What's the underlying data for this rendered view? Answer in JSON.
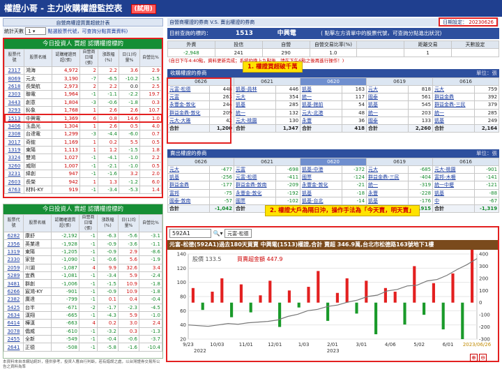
{
  "header": {
    "title": "權證小哥 - 主力收購權證監控表",
    "tag": "(試用)"
  },
  "left_controls": {
    "subtitle": "自營商權證買賣超統計表",
    "days_label": "統計天數",
    "days_value": "1",
    "hint": "點選股票代號，可查詢分點買賣資料)"
  },
  "foreign": {
    "title": "今日投資人 買超 認購權證標的",
    "headers": [
      "股票代號",
      "股票名稱",
      "認購權證買超(張)",
      "自營商日增(張)",
      "漲跌幅(%)",
      "日(1)均量%",
      "自營比%"
    ],
    "rows": [
      [
        "2317",
        "鴻海",
        "4,972",
        "2",
        "2.2",
        "3.6",
        "2.9"
      ],
      [
        "8069",
        "元太",
        "3,190",
        "-7",
        "-6.5",
        "-10.2",
        "-1.5"
      ],
      [
        "2618",
        "長榮航",
        "2,973",
        "2",
        "2.2",
        "0.0",
        "2.5"
      ],
      [
        "2303",
        "聯電",
        "1,964",
        "-1",
        "-1.1",
        "-2.2",
        "19.7"
      ],
      [
        "3443",
        "創意",
        "1,804",
        "-3",
        "-0.6",
        "-1.8",
        "0.3"
      ],
      [
        "3293",
        "鈊象",
        "1,768",
        "1",
        "2.6",
        "2.6",
        "10.7"
      ],
      [
        "1513",
        "中興電",
        "1,369",
        "6",
        "0.8",
        "14.6",
        "1.0"
      ],
      [
        "3406",
        "玉晶光",
        "1,304",
        "1",
        "2.6",
        "0.5",
        "4.0"
      ],
      [
        "2308",
        "台達電",
        "1,299",
        "-3",
        "-4.4",
        "-6.0",
        "0.7"
      ],
      [
        "3017",
        "奇鋐",
        "1,169",
        "1",
        "0.2",
        "5.5",
        "0.5"
      ],
      [
        "1319",
        "東陽",
        "1,113",
        "1",
        "1.2",
        "-1.5",
        "1.8"
      ],
      [
        "3324",
        "雙鴻",
        "1,027",
        "-1",
        "-4.1",
        "-1.0",
        "2.2"
      ],
      [
        "3260",
        "威剛",
        "1,007",
        "-1",
        "-2.1",
        "-1.0",
        "0.5"
      ],
      [
        "3231",
        "緯創",
        "947",
        "-1",
        "-1.6",
        "3.2",
        "2.0"
      ],
      [
        "2603",
        "長榮",
        "942",
        "1",
        "1.3",
        "-1.2",
        "6.0"
      ],
      [
        "4763",
        "材料-KY",
        "919",
        "-1",
        "-3.4",
        "-5.3",
        "1.4"
      ]
    ]
  },
  "dealer": {
    "title": "今日投資人 賣超 認購權證標的",
    "headers": [
      "股票代號",
      "股票名稱",
      "認購權證賣超(張)",
      "自營商日增(張)",
      "漲跌幅(%)",
      "日(1)均量%",
      "自營比%"
    ],
    "rows": [
      [
        "6282",
        "康舒",
        "-2,192",
        "-1",
        "-6.3",
        "-5.6",
        "-3.1"
      ],
      [
        "2356",
        "英業達",
        "-1,928",
        "-1",
        "-0.9",
        "-3.6",
        "-1.1"
      ],
      [
        "1319",
        "東陽",
        "-1,205",
        "-1",
        "-0.9",
        "2.9",
        "-8.6"
      ],
      [
        "2330",
        "家登",
        "-1,090",
        "-1",
        "-0.6",
        "5.6",
        "-1.9"
      ],
      [
        "2059",
        "川湖",
        "-1,087",
        "4",
        "9.9",
        "32.6",
        "3.4"
      ],
      [
        "5289",
        "宜鼎",
        "-1,081",
        "-1",
        "-3.4",
        "5.9",
        "-2.4"
      ],
      [
        "3481",
        "群創",
        "-1,006",
        "-1",
        "-1.5",
        "10.9",
        "-1.8"
      ],
      [
        "6266",
        "宸鴻-KY",
        "-901",
        "-1",
        "-0.9",
        "10.9",
        "-1.8"
      ],
      [
        "2382",
        "廣達",
        "-799",
        "-1",
        "0.1",
        "0.4",
        "-0.4"
      ],
      [
        "5425",
        "台半",
        "-671",
        "-2",
        "-1.7",
        "-2.3",
        "-4.5"
      ],
      [
        "2634",
        "漢翔",
        "-665",
        "-1",
        "-4.3",
        "5.9",
        "-1.0"
      ],
      [
        "6414",
        "樺漢",
        "-663",
        "4",
        "0.2",
        "3.0",
        "2.4"
      ],
      [
        "3078",
        "僑威",
        "-610",
        "-1",
        "-3.2",
        "0.3",
        "-1.3"
      ],
      [
        "2455",
        "全新",
        "-549",
        "-1",
        "-0.4",
        "-0.6",
        "-3.7"
      ],
      [
        "2641",
        "正德",
        "-508",
        "-1",
        "-5.8",
        "-1.6",
        "-10.4"
      ]
    ]
  },
  "footnote": "本資料來自本網站統計，僅供參考，投資人應自行判斷，若有錯誤之處，以台灣證券交易所公告之資料為準",
  "right": {
    "subtitle": "自營商權證的券商 V.S. 賣出權證的券商",
    "date_label": "日期設定",
    "date_value": "20230626",
    "target_label": "目前查詢的標的：",
    "target_code": "1513",
    "target_name": "中興電",
    "target_hint": "( 點擊左方清單中的股票代號，可查詢分點進出狀況)",
    "summary_headers": [
      "外資",
      "投信",
      "自營",
      "自營交易比率(%)",
      "",
      "距離交易",
      "天數設定"
    ],
    "summary_values": [
      "-2,948",
      "241",
      "290",
      "1.0",
      "",
      "1",
      ""
    ],
    "note": "(自日下午4:40點，資料更新完成；系統約晚上九點後，請在下午6點之後再進行操作！)",
    "unit": "單位：張",
    "buy_title": "收購權證的券商",
    "sell_title": "賣出權證的券商",
    "dates": [
      "0626",
      "0621",
      "0620",
      "0619",
      "0616"
    ],
    "buy_rows": [
      [
        [
          "元富-松德",
          "448"
        ],
        [
          "凱基-員林",
          "446"
        ],
        [
          "凱基",
          "163"
        ],
        [
          "元大",
          "818"
        ],
        [
          "元大",
          "759"
        ]
      ],
      [
        [
          "元富",
          "263"
        ],
        [
          "元大",
          "354"
        ],
        [
          "統一",
          "117"
        ],
        [
          "國泰",
          "561"
        ],
        [
          "群益金鼎",
          "392"
        ]
      ],
      [
        [
          "永豐金-敦化",
          "244"
        ],
        [
          "凱基",
          "285"
        ],
        [
          "凱基-館前",
          "54"
        ],
        [
          "凱基",
          "545"
        ],
        [
          "群益金鼎-三民",
          "379"
        ]
      ],
      [
        [
          "群益金鼎-敦化",
          "209"
        ],
        [
          "統一",
          "132"
        ],
        [
          "元大-北港",
          "48"
        ],
        [
          "統一",
          "203"
        ],
        [
          "統一",
          "285"
        ]
      ],
      [
        [
          "元大-大雅",
          "42"
        ],
        [
          "元大-桃園",
          "130"
        ],
        [
          "永豐",
          "36"
        ],
        [
          "國泰",
          "133"
        ],
        [
          "凱基",
          "249"
        ]
      ]
    ],
    "buy_totals": [
      "1,200",
      "1,347",
      "418",
      "2,260",
      "2,164"
    ],
    "sell_rows": [
      [
        [
          "元大",
          "-477"
        ],
        [
          "元富",
          "-698"
        ],
        [
          "凱基-中港",
          "-372"
        ],
        [
          "元大",
          "-685"
        ],
        [
          "元大-桃園",
          "-901"
        ]
      ],
      [
        [
          "凱基",
          "-256"
        ],
        [
          "元富-松德",
          "-411"
        ],
        [
          "國票",
          "-124"
        ],
        [
          "群益金鼎-三民",
          "-404"
        ],
        [
          "富邦-木柵",
          "-141"
        ]
      ],
      [
        [
          "群益金鼎",
          "-177"
        ],
        [
          "群益金鼎-敦南",
          "-209"
        ],
        [
          "永豐金-敦化",
          "-21"
        ],
        [
          "統一",
          "-319"
        ],
        [
          "統一中壢",
          "-121"
        ]
      ],
      [
        [
          "富邦",
          "-75"
        ],
        [
          "永豐金-敦化",
          "-192"
        ],
        [
          "凱基",
          "-18"
        ],
        [
          "永豐",
          "-228"
        ],
        [
          "凱基",
          "-88"
        ]
      ],
      [
        [
          "國泰-敦南",
          "-57"
        ],
        [
          "國票",
          "-102"
        ],
        [
          "凱基-台北",
          "-14"
        ],
        [
          "凱基",
          "-176"
        ],
        [
          "中",
          "-67"
        ]
      ]
    ],
    "sell_totals": [
      "-1,042",
      "-1,683",
      "-433",
      "-1,915",
      "-1,319"
    ],
    "total_label": "合計",
    "callout1": "1. 權證買超破千萬",
    "callout2": "2. 權證大戶為隔日沖，操作手法為「今天賣，明天賣」"
  },
  "chart_panel": {
    "input_value": "592A1",
    "branch_btn": "元富-松德",
    "banner": "元富-松德(592A1)過去180天買賣 中興電(1513)權證,合計 賣超 346.9萬,台北市松德路163號地下1樓",
    "legend_price": "股價",
    "legend_price_value": "133.5",
    "legend_buy": "買賣超金額",
    "legend_buy_value": "447.9"
  },
  "chart_data": {
    "type": "bar",
    "x": [
      "9/23",
      "10/03",
      "11/01",
      "12/01",
      "1/03",
      "2/01",
      "3/01",
      "4/06",
      "5/02",
      "6/01",
      "2023/06/26"
    ],
    "x_year_labels": [
      "2022",
      "2023",
      "2022"
    ],
    "left_ticks": [
      140,
      120,
      100,
      80,
      60,
      40,
      20
    ],
    "right_ticks": [
      400,
      300,
      200,
      100,
      0,
      -100,
      -200,
      -300
    ],
    "series": [
      {
        "name": "股價",
        "type": "line",
        "values": [
          40,
          39,
          38,
          40,
          42,
          41,
          43,
          44,
          45,
          47,
          52,
          55,
          60,
          62,
          66,
          68,
          72,
          75,
          80,
          82,
          88,
          90,
          95,
          96,
          102,
          104,
          110,
          118,
          125,
          133.5
        ]
      },
      {
        "name": "買賣超金額",
        "type": "bar",
        "values": [
          120,
          -60,
          90,
          200,
          -120,
          150,
          -80,
          60,
          180,
          -200,
          100,
          -40,
          130,
          260,
          -150,
          80,
          200,
          -90,
          180,
          -260,
          120,
          90,
          -180,
          300,
          -100,
          160,
          -220,
          240,
          -300,
          447.9
        ]
      }
    ],
    "ylim_left": [
      20,
      140
    ],
    "ylim_right": [
      -300,
      400
    ]
  },
  "colors": {
    "header_bg": "#1f3f8f",
    "green": "#158e35",
    "blue": "#2d4f9e",
    "red": "#e32020",
    "buy_bar": "#e32020",
    "sell_bar": "#1a9a2a"
  }
}
